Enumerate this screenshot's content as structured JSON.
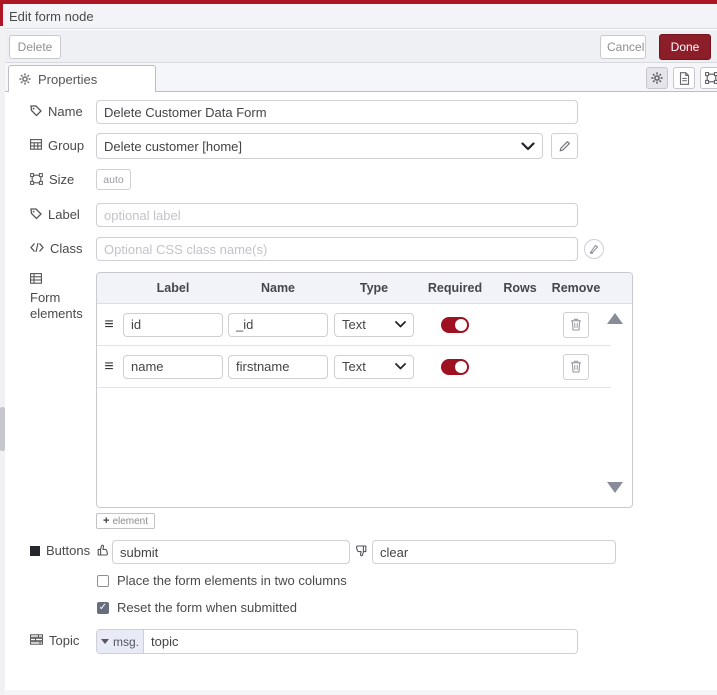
{
  "window": {
    "title": "Edit form node"
  },
  "colors": {
    "accent_red": "#ad1625",
    "done_button_red": "#8c1e2a",
    "toggle_red": "#9d1120",
    "header_bg": "#f3f4f7",
    "table_header_bg": "#f2f3f8"
  },
  "toolbar": {
    "delete_label": "Delete",
    "cancel_label": "Cancel",
    "done_label": "Done"
  },
  "tabs": {
    "properties_label": "Properties"
  },
  "fields": {
    "name": {
      "label": "Name",
      "value": "Delete Customer Data Form"
    },
    "group": {
      "label": "Group",
      "value": "Delete customer [home]"
    },
    "size": {
      "label": "Size",
      "value": "auto"
    },
    "label": {
      "label": "Label",
      "placeholder": "optional label"
    },
    "class": {
      "label": "Class",
      "placeholder": "Optional CSS class name(s)"
    }
  },
  "form_elements": {
    "label_line1": "Form",
    "label_line2": "elements",
    "columns": [
      "Label",
      "Name",
      "Type",
      "Required",
      "Rows",
      "Remove"
    ],
    "rows": [
      {
        "label_value": "id",
        "name_value": "_id",
        "type": "Text",
        "required": true
      },
      {
        "label_value": "name",
        "name_value": "firstname",
        "type": "Text",
        "required": true
      }
    ],
    "add_button_label": "element"
  },
  "buttons_section": {
    "label": "Buttons",
    "submit_value": "submit",
    "clear_value": "clear"
  },
  "checkboxes": [
    {
      "label": "Place the form elements in two columns",
      "checked": false
    },
    {
      "label": "Reset the form when submitted",
      "checked": true,
      "check_glyph": "✓"
    }
  ],
  "topic": {
    "label": "Topic",
    "prefix": "msg.",
    "value": "topic"
  }
}
